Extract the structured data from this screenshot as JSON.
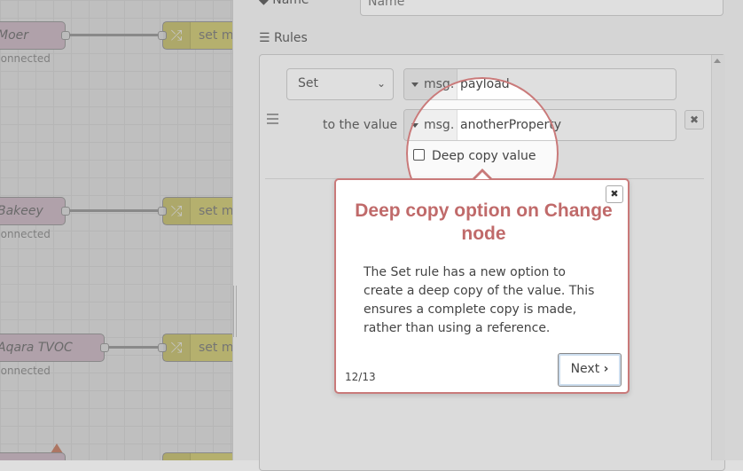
{
  "workspace": {
    "nodes": [
      {
        "label": "Moer",
        "status": "connected"
      },
      {
        "label": "Bakeey",
        "status": "connected"
      },
      {
        "label": "Aqara TVOC",
        "status": "connected"
      }
    ],
    "change_nodes": [
      {
        "label": "set m"
      },
      {
        "label": "set m"
      },
      {
        "label": "set m"
      }
    ]
  },
  "editor": {
    "name_label": "Name",
    "name_placeholder": "Name",
    "rules_label": "Rules",
    "rule": {
      "action": "Set",
      "target_type": "msg.",
      "target_value": "payload",
      "to_label": "to the value",
      "value_type": "msg.",
      "value_value": "anotherProperty",
      "deep_copy_label": "Deep copy value"
    }
  },
  "tour": {
    "title": "Deep copy option on Change node",
    "body": "The Set rule has a new option to create a deep copy of the value. This ensures a complete copy is made, rather than using a reference.",
    "step": "12/13",
    "next_label": "Next",
    "close_glyph": "✖",
    "accent_color": "#c06a6a"
  }
}
